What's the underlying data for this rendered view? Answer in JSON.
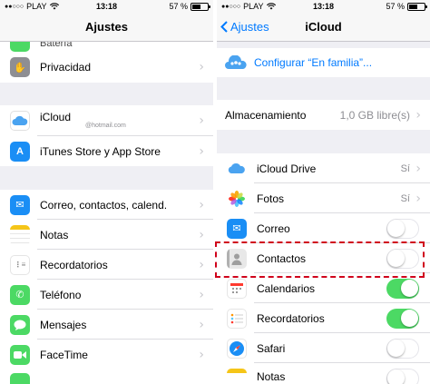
{
  "colors": {
    "accent": "#007aff",
    "toggle_on": "#4cd964",
    "highlight": "#d0021b"
  },
  "left": {
    "status": {
      "carrier": "PLAY",
      "time": "13:18",
      "battery": "57 %",
      "battery_level": 0.57
    },
    "nav_title": "Ajustes",
    "rows": [
      {
        "label": "Batería",
        "icon": "battery-icon"
      },
      {
        "label": "Privacidad",
        "icon": "hand-icon"
      },
      {
        "label": "iCloud",
        "sublabel": "@hotmail.com",
        "icon": "icloud-icon"
      },
      {
        "label": "iTunes Store y App Store",
        "icon": "app-store-icon"
      },
      {
        "label": "Correo, contactos, calend.",
        "icon": "mail-icon"
      },
      {
        "label": "Notas",
        "icon": "notes-icon"
      },
      {
        "label": "Recordatorios",
        "icon": "reminders-icon"
      },
      {
        "label": "Teléfono",
        "icon": "phone-icon"
      },
      {
        "label": "Mensajes",
        "icon": "messages-icon"
      },
      {
        "label": "FaceTime",
        "icon": "facetime-icon"
      }
    ]
  },
  "right": {
    "status": {
      "carrier": "PLAY",
      "time": "13:18",
      "battery": "57 %",
      "battery_level": 0.57
    },
    "back_label": "Ajustes",
    "nav_title": "iCloud",
    "family_label": "Configurar “En familia”...",
    "storage": {
      "label": "Almacenamiento",
      "value": "1,0 GB libre(s)"
    },
    "apps": [
      {
        "label": "iCloud Drive",
        "value": "Sí",
        "icon": "icloud-drive-icon",
        "type": "detail"
      },
      {
        "label": "Fotos",
        "value": "Sí",
        "icon": "photos-icon",
        "type": "detail"
      },
      {
        "label": "Correo",
        "icon": "mail-icon",
        "type": "toggle",
        "on": false
      },
      {
        "label": "Contactos",
        "icon": "contacts-icon",
        "type": "toggle",
        "on": false
      },
      {
        "label": "Calendarios",
        "icon": "calendar-icon",
        "type": "toggle",
        "on": true
      },
      {
        "label": "Recordatorios",
        "icon": "reminders-icon",
        "type": "toggle",
        "on": true
      },
      {
        "label": "Safari",
        "icon": "safari-icon",
        "type": "toggle",
        "on": false
      },
      {
        "label": "Notas",
        "icon": "notes-icon",
        "type": "toggle",
        "on": false
      }
    ]
  }
}
